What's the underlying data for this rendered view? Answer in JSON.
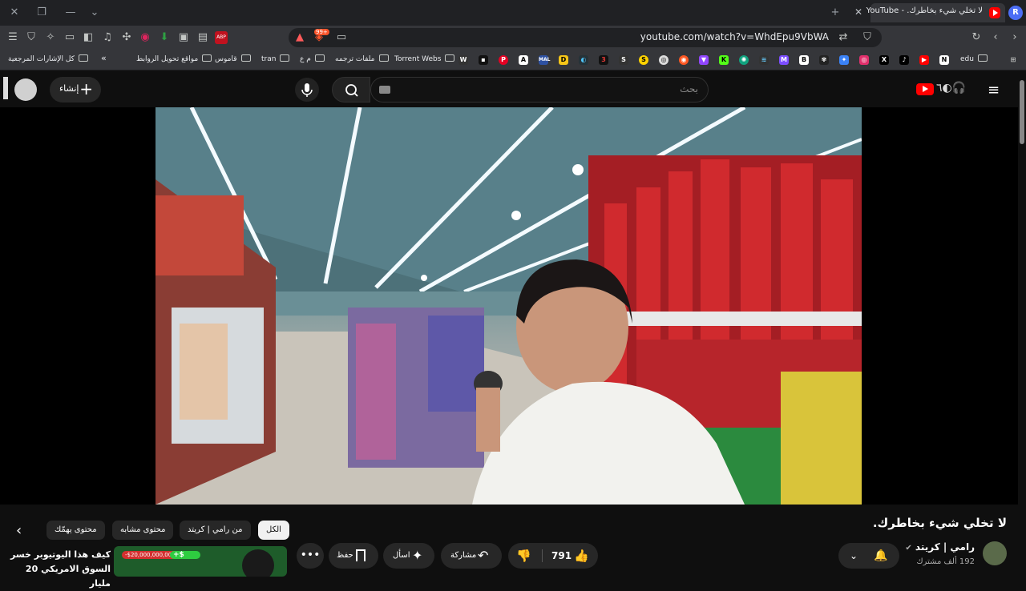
{
  "browser": {
    "tab_title": "لا تخلي شيء بخاطرك. - YouTube",
    "profile_initial": "R",
    "url": "youtube.com/watch?v=WhdEpu9VbWA",
    "badge_count": "99+",
    "bookmarks": [
      {
        "label": "كل الإشارات المرجعية",
        "type": "folder"
      },
      {
        "label": "مواقع تحويل الروابط",
        "type": "folder"
      },
      {
        "label": "قاموس",
        "type": "folder"
      },
      {
        "label": "tran",
        "type": "folder"
      },
      {
        "label": "م ع",
        "type": "folder"
      },
      {
        "label": "ملفات ترجمه",
        "type": "folder"
      },
      {
        "label": "Torrent Webs",
        "type": "folder"
      },
      {
        "label": "edu",
        "type": "folder"
      }
    ],
    "bookmark_more": "»"
  },
  "youtube": {
    "search_placeholder": "بحث",
    "create_label": "إنشاء",
    "video_title": "لا تخلي شيء بخاطرك.",
    "channel_name": "رامي | كريتد",
    "subscribers": "192 ألف مشترك",
    "likes": "791",
    "share_label": "مشاركة",
    "ask_label": "اسأل",
    "save_label": "حفظ",
    "chips": [
      {
        "label": "الكل",
        "active": true
      },
      {
        "label": "من رامي | كريتد",
        "active": false
      },
      {
        "label": "محتوى مشابه",
        "active": false
      },
      {
        "label": "محتوى يهمّك",
        "active": false
      }
    ],
    "recommendation": {
      "title": "كيف هذا اليوتيوبر خسر السوق الامريكي 20 مليار",
      "thumb_text_1": "-$20,000,000,000",
      "thumb_text_2": "+$"
    }
  },
  "colors": {
    "youtube_red": "#ff0000",
    "bg": "#0f0f0f",
    "chip": "#272727"
  }
}
